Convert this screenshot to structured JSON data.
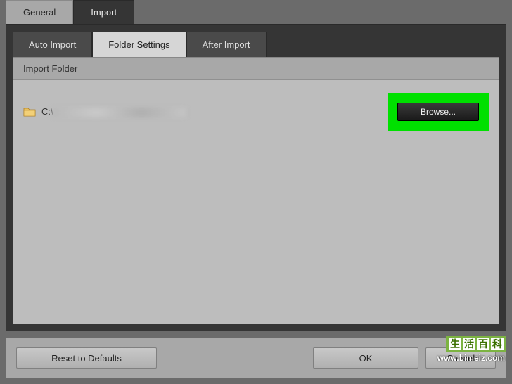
{
  "outerTabs": {
    "general": "General",
    "import": "Import"
  },
  "innerTabs": {
    "autoImport": "Auto Import",
    "folderSettings": "Folder Settings",
    "afterImport": "After Import"
  },
  "section": {
    "header": "Import Folder"
  },
  "folder": {
    "pathPrefix": "C:\\"
  },
  "buttons": {
    "browse": "Browse...",
    "reset": "Reset to Defaults",
    "ok": "OK",
    "cancel": "Cancel"
  },
  "watermark": {
    "c1": "生",
    "c2": "活",
    "c3": "百",
    "c4": "科",
    "url": "www.bimeiz.com"
  }
}
